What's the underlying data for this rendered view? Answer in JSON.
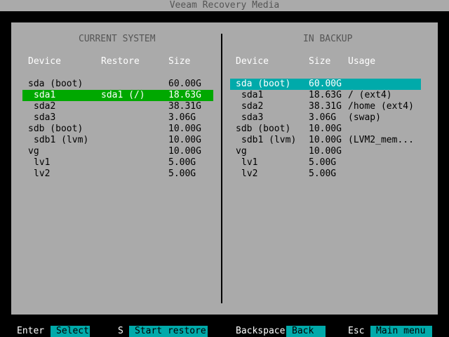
{
  "title": "Veeam Recovery Media",
  "left": {
    "heading": "CURRENT SYSTEM",
    "columns": [
      "Device",
      "Restore",
      "Size"
    ],
    "rows": [
      {
        "device": "sda (boot)",
        "restore": "",
        "size": "60.00G",
        "indent": 0
      },
      {
        "device": "sda1",
        "restore": "sda1 (/)",
        "size": "18.63G",
        "indent": 1,
        "selected": true
      },
      {
        "device": "sda2",
        "restore": "",
        "size": "38.31G",
        "indent": 1
      },
      {
        "device": "sda3",
        "restore": "",
        "size": "3.06G",
        "indent": 1
      },
      {
        "device": "sdb (boot)",
        "restore": "",
        "size": "10.00G",
        "indent": 0
      },
      {
        "device": "sdb1 (lvm)",
        "restore": "",
        "size": "10.00G",
        "indent": 1
      },
      {
        "device": "vg",
        "restore": "",
        "size": "10.00G",
        "indent": 0
      },
      {
        "device": "lv1",
        "restore": "",
        "size": "5.00G",
        "indent": 1
      },
      {
        "device": "lv2",
        "restore": "",
        "size": "5.00G",
        "indent": 1
      }
    ]
  },
  "right": {
    "heading": "IN BACKUP",
    "columns": [
      "Device",
      "Size",
      "Usage"
    ],
    "rows": [
      {
        "device": "sda (boot)",
        "size": "60.00G",
        "usage": "",
        "indent": 0,
        "selected": true
      },
      {
        "device": "sda1",
        "size": "18.63G",
        "usage": "/ (ext4)",
        "indent": 1
      },
      {
        "device": "sda2",
        "size": "38.31G",
        "usage": "/home (ext4)",
        "indent": 1
      },
      {
        "device": "sda3",
        "size": "3.06G",
        "usage": "(swap)",
        "indent": 1
      },
      {
        "device": "sdb (boot)",
        "size": "10.00G",
        "usage": "",
        "indent": 0
      },
      {
        "device": "sdb1 (lvm)",
        "size": "10.00G",
        "usage": "(LVM2_mem...",
        "indent": 1
      },
      {
        "device": "vg",
        "size": "10.00G",
        "usage": "",
        "indent": 0
      },
      {
        "device": "lv1",
        "size": "5.00G",
        "usage": "",
        "indent": 1
      },
      {
        "device": "lv2",
        "size": "5.00G",
        "usage": "",
        "indent": 1
      }
    ]
  },
  "footer": [
    {
      "key": "Enter",
      "action": "Select"
    },
    {
      "key": "S",
      "action": "Start restore"
    },
    {
      "key": "Backspace",
      "action": "Back"
    },
    {
      "key": "Esc",
      "action": "Main menu"
    }
  ]
}
